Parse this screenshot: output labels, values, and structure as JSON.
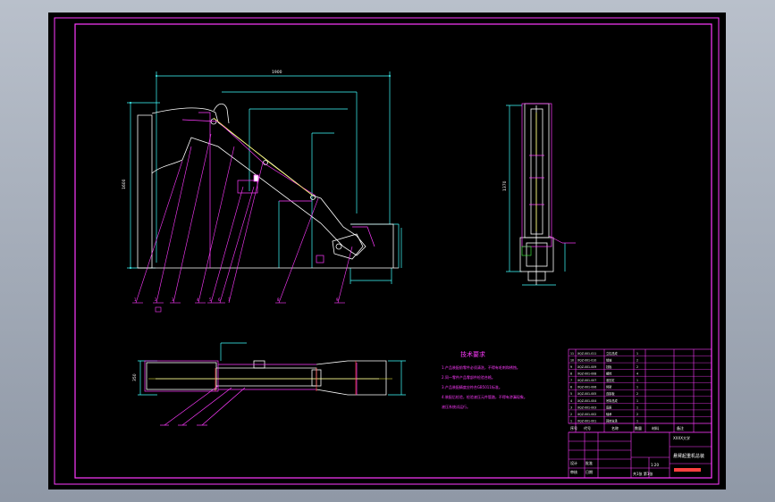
{
  "colors": {
    "frame": "#ff3aff",
    "dim": "#40ffff",
    "part": "#ffffff",
    "leader": "#ff4040",
    "note": "#ff3aff",
    "green": "#40ff40"
  },
  "dimensions": {
    "overall_width": "1900",
    "overall_height": "1600",
    "side_height": "1370",
    "top_height": "350"
  },
  "balloons": [
    "1",
    "2",
    "3",
    "4",
    "5",
    "6",
    "7",
    "8",
    "9"
  ],
  "tech_notes": {
    "title": "技术要求",
    "lines": [
      "1.产品装配前零件必须清洗，不得有毛刺和锈蚀。",
      "2.同一零件产品零部件检验合格。",
      "3.产品装配精度应符合GB5011标准。",
      "4.装配后检验，检验液压元件管路，不得有渗漏现象。",
      "液压系统试运行。"
    ]
  },
  "title_block": {
    "drawing_title": "悬臂起重机总装",
    "company": "XXXX大学",
    "scale": "1:20",
    "sheet": "共1张 第1张",
    "label_designer": "设计",
    "label_checker": "审核",
    "label_approve": "批准",
    "label_date": "日期"
  },
  "parts_list": [
    {
      "no": "11",
      "code": "XQZ-001-011",
      "name": "立柱总成",
      "qty": "1"
    },
    {
      "no": "10",
      "code": "XQZ-001-010",
      "name": "销轴",
      "qty": "2"
    },
    {
      "no": "9",
      "code": "XQZ-001-009",
      "name": "挡板",
      "qty": "2"
    },
    {
      "no": "8",
      "code": "XQZ-001-008",
      "name": "螺栓",
      "qty": "4"
    },
    {
      "no": "7",
      "code": "XQZ-001-007",
      "name": "液压缸",
      "qty": "1"
    },
    {
      "no": "6",
      "code": "XQZ-001-006",
      "name": "臂架",
      "qty": "1"
    },
    {
      "no": "5",
      "code": "XQZ-001-005",
      "name": "连接板",
      "qty": "2"
    },
    {
      "no": "4",
      "code": "XQZ-001-004",
      "name": "吊钩总成",
      "qty": "1"
    },
    {
      "no": "3",
      "code": "XQZ-001-003",
      "name": "底座",
      "qty": "1"
    },
    {
      "no": "2",
      "code": "XQZ-001-002",
      "name": "轴承",
      "qty": "2"
    },
    {
      "no": "1",
      "code": "XQZ-001-001",
      "name": "回转支承",
      "qty": "1"
    }
  ],
  "parts_header": {
    "no": "序号",
    "code": "代号",
    "name": "名称",
    "qty": "数量",
    "material": "材料",
    "remark": "备注"
  }
}
